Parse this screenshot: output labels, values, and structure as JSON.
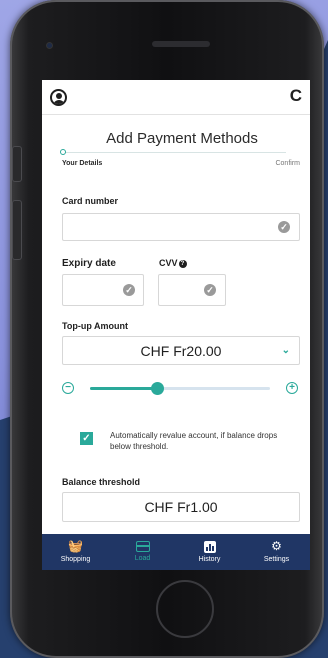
{
  "header": {
    "profile_icon": "user-circle-icon",
    "refresh_icon": "refresh-icon",
    "refresh_glyph": "C"
  },
  "page": {
    "title": "Add Payment Methods",
    "steps": {
      "left": "Your Details",
      "right": "Confirm"
    }
  },
  "card_number": {
    "label": "Card number",
    "value": "",
    "icon": "check-circle-icon"
  },
  "expiry": {
    "label": "Expiry date",
    "value": ""
  },
  "cvv": {
    "label": "CVV",
    "value": ""
  },
  "topup": {
    "label": "Top-up Amount",
    "value": "CHF Fr20.00",
    "slider_fraction": 0.37
  },
  "auto_revalue": {
    "checked": true,
    "label": "Automatically revalue account, if balance drops below threshold."
  },
  "threshold": {
    "label": "Balance threshold",
    "value": "CHF Fr1.00"
  },
  "nav": {
    "items": [
      {
        "label": "Shopping",
        "icon": "shopping-basket-icon"
      },
      {
        "label": "Load",
        "icon": "card-icon",
        "active": true
      },
      {
        "label": "History",
        "icon": "bar-chart-icon"
      },
      {
        "label": "Settings",
        "icon": "gear-icon"
      }
    ]
  },
  "colors": {
    "accent": "#2aa99a",
    "nav_bg": "#203665",
    "background": "#26406e"
  }
}
